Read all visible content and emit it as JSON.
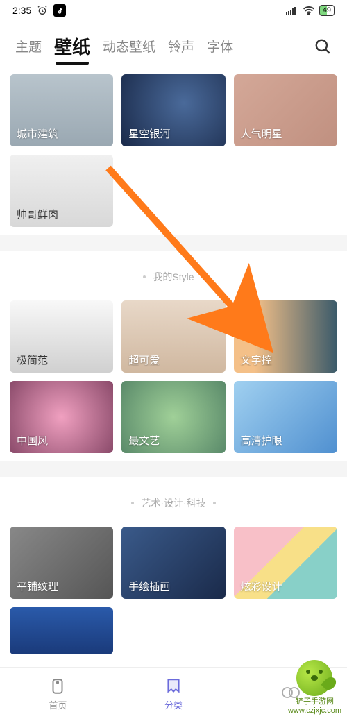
{
  "status": {
    "time": "2:35",
    "battery": "49"
  },
  "tabs": [
    "主题",
    "壁纸",
    "动态壁纸",
    "铃声",
    "字体"
  ],
  "activeTab": 1,
  "section1": {
    "items": [
      "城市建筑",
      "星空银河",
      "人气明星",
      "帅哥鲜肉"
    ]
  },
  "section2": {
    "title": "我的Style",
    "items": [
      "极简范",
      "超可爱",
      "文字控",
      "中国风",
      "最文艺",
      "高清护眼"
    ]
  },
  "section3": {
    "title": "艺术·设计·科技",
    "items": [
      "平铺纹理",
      "手绘插画",
      "炫彩设计"
    ]
  },
  "nav": {
    "items": [
      "首页",
      "分类",
      ""
    ],
    "active": 1
  },
  "watermark": "铲子手游网\nwww.czjxjc.com"
}
